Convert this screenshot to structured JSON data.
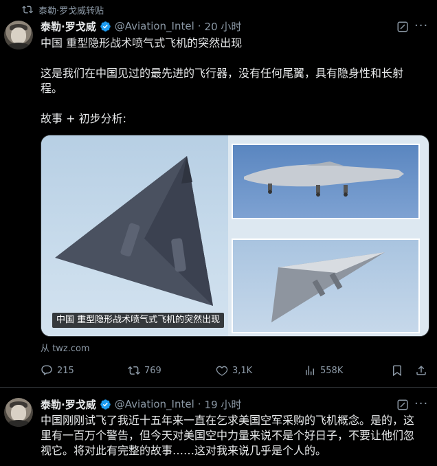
{
  "repost": {
    "label": "泰勒·罗戈威转贴"
  },
  "tweet1": {
    "name": "泰勒·罗戈威",
    "handle": "@Aviation_Intel",
    "separator": "·",
    "time": "20 小时",
    "lines": [
      "中国 重型隐形战术喷气式飞机的突然出现",
      "这是我们在中国见过的最先进的飞行器，没有任何尾翼，具有隐身性和长射",
      "程。",
      "故事 + 初步分析:"
    ],
    "media_caption": "中国 重型隐形战术喷气式飞机的突然出现",
    "source": "从 twz.com",
    "stats": {
      "replies": "215",
      "reposts": "769",
      "likes": "3,1K",
      "views": "558K"
    }
  },
  "tweet2": {
    "name": "泰勒·罗戈威",
    "handle": "@Aviation_Intel",
    "separator": "·",
    "time": "19 小时",
    "lines": [
      "中国刚刚试飞了我近十五年来一直在乞求美国空军采购的飞机概念。是的，这",
      "里有一百万个警告，但今天对美国空中力量来说不是个好日子，不要让他们忽",
      "视它。将对此有完整的故事……这对我来说几乎是个人的。"
    ]
  },
  "icons": {
    "repost": "repost-icon",
    "verified": "verified-badge-icon",
    "grok": "grok-icon",
    "more": "more-icon",
    "reply": "reply-icon",
    "like": "heart-icon",
    "views": "views-icon",
    "bookmark": "bookmark-icon",
    "share": "share-icon"
  },
  "colors": {
    "verified": "#1d9bf0",
    "muted": "#8b98a5",
    "text": "#e7e9ea",
    "background": "#000000"
  }
}
